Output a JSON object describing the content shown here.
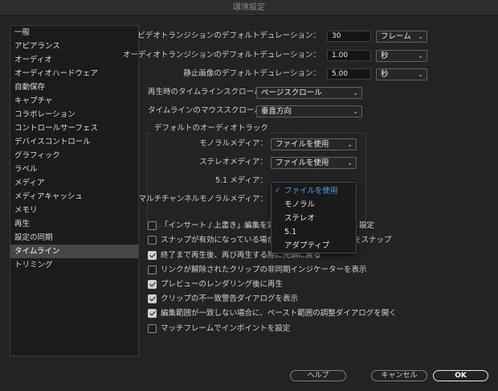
{
  "window": {
    "title": "環境設定"
  },
  "sidebar": {
    "items": [
      {
        "label": "一般"
      },
      {
        "label": "アピアランス"
      },
      {
        "label": "オーディオ"
      },
      {
        "label": "オーディオハードウェア"
      },
      {
        "label": "自動保存"
      },
      {
        "label": "キャプチャ"
      },
      {
        "label": "コラボレーション"
      },
      {
        "label": "コントロールサーフェス"
      },
      {
        "label": "デバイスコントロール"
      },
      {
        "label": "グラフィック"
      },
      {
        "label": "ラベル"
      },
      {
        "label": "メディア"
      },
      {
        "label": "メディアキャッシュ"
      },
      {
        "label": "メモリ"
      },
      {
        "label": "再生"
      },
      {
        "label": "設定の同期"
      },
      {
        "label": "タイムライン"
      },
      {
        "label": "トリミング"
      }
    ],
    "selected": "タイムライン"
  },
  "durations": {
    "video": {
      "label": "ビデオトランジションのデフォルトデュレーション：",
      "value": "30",
      "unit": "フレーム"
    },
    "audio": {
      "label": "オーディオトランジションのデフォルトデュレーション：",
      "value": "1.00",
      "unit": "秒"
    },
    "still": {
      "label": "静止画像のデフォルトデュレーション：",
      "value": "5.00",
      "unit": "秒"
    }
  },
  "playback_scroll": {
    "label": "再生時のタイムラインスクロール：",
    "value": "ページスクロール"
  },
  "mouse_scroll": {
    "label": "タイムラインのマウススクロール：",
    "value": "垂直方向"
  },
  "default_audio_tracks": {
    "title": "デフォルトのオーディオトラック",
    "mono": {
      "label": "モノラルメディア：",
      "value": "ファイルを使用"
    },
    "stereo": {
      "label": "ステレオメディア：",
      "value": "ファイルを使用"
    },
    "five_one": {
      "label": "5.1 メディア："
    },
    "multichannel": {
      "label": "マルチチャンネルモノラルメディア："
    }
  },
  "stereo_dropdown": {
    "options": [
      {
        "label": "ファイルを使用",
        "selected": true,
        "check": "✓"
      },
      {
        "label": "モノラル",
        "selected": false
      },
      {
        "label": "ステレオ",
        "selected": false
      },
      {
        "label": "5.1",
        "selected": false
      },
      {
        "label": "アダプティブ",
        "selected": false
      }
    ]
  },
  "checkboxes": [
    {
      "left": "「インサート / 上書き」編集を実行",
      "right": "設定",
      "checked": false
    },
    {
      "left": "スナップが有効になっている場合に、",
      "right": "をスナップ",
      "checked": false
    },
    {
      "left": "終了まで再生後、再び再生する際に先頭に戻る",
      "checked": true
    },
    {
      "left": "リンクが解除されたクリップの非同期インジケーターを表示",
      "checked": false
    },
    {
      "left": "プレビューのレンダリング後に再生",
      "checked": true
    },
    {
      "left": "クリップの不一致警告ダイアログを表示",
      "checked": true
    },
    {
      "left": "編集範囲が一致しない場合に、ペースト範囲の調整ダイアログを開く",
      "checked": true
    },
    {
      "left": "マッチフレームでインポイントを設定",
      "checked": false
    }
  ],
  "buttons": {
    "help": "ヘルプ",
    "cancel": "キャンセル",
    "ok": "OK"
  },
  "icons": {
    "chevron": "chevron-down-icon",
    "check": "checkmark-icon"
  },
  "colors": {
    "accent": "#4aa3f7",
    "selected_item": "#474747"
  }
}
